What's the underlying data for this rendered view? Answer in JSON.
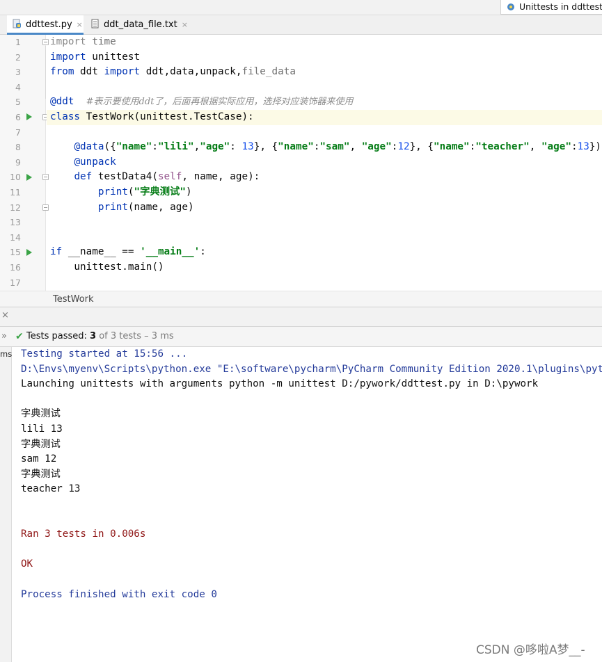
{
  "run_config": {
    "label": "Unittests in ddttest.py"
  },
  "tabs": [
    {
      "label": "ddttest.py",
      "close": "×",
      "active": true
    },
    {
      "label": "ddt_data_file.txt",
      "close": "×",
      "active": false
    }
  ],
  "editor": {
    "line_numbers": [
      "1",
      "2",
      "3",
      "4",
      "5",
      "6",
      "7",
      "8",
      "9",
      "10",
      "11",
      "12",
      "13",
      "14",
      "15",
      "16",
      "17"
    ]
  },
  "breadcrumb": "TestWork",
  "run_window": {
    "close_glyph": "×",
    "toggle_glyph": "»",
    "check_glyph": "✔",
    "status": {
      "prefix": "Tests passed: ",
      "passed": "3",
      "rest": " of 3 tests – 3 ms"
    },
    "side_label": "ms"
  },
  "console_lines": [
    {
      "text": "Testing started at 15:56 ...",
      "kind": "blue"
    },
    {
      "text": "D:\\Envs\\myenv\\Scripts\\python.exe \"E:\\software\\pycharm\\PyCharm Community Edition 2020.1\\plugins\\python-",
      "kind": "blue"
    },
    {
      "text": "Launching unittests with arguments python -m unittest D:/pywork/ddttest.py in D:\\pywork",
      "kind": "out"
    },
    {
      "text": "",
      "kind": "out"
    },
    {
      "text": "字典测试",
      "kind": "out"
    },
    {
      "text": "lili 13",
      "kind": "out"
    },
    {
      "text": "字典测试",
      "kind": "out"
    },
    {
      "text": "sam 12",
      "kind": "out"
    },
    {
      "text": "字典测试",
      "kind": "out"
    },
    {
      "text": "teacher 13",
      "kind": "out"
    },
    {
      "text": "",
      "kind": "out"
    },
    {
      "text": "",
      "kind": "out"
    },
    {
      "text": "Ran 3 tests in 0.006s",
      "kind": "red"
    },
    {
      "text": "",
      "kind": "out"
    },
    {
      "text": "OK",
      "kind": "red"
    },
    {
      "text": "",
      "kind": "out"
    },
    {
      "text": "Process finished with exit code 0",
      "kind": "blue"
    }
  ],
  "watermark": "CSDN @哆啦A梦__-",
  "colors": {
    "keyword": "#0033b3",
    "string": "#067d17",
    "number": "#1750eb",
    "decorator": "#9e880d",
    "run_green": "#3aa346",
    "console_blue": "#243b9a",
    "console_red": "#8f1515"
  }
}
